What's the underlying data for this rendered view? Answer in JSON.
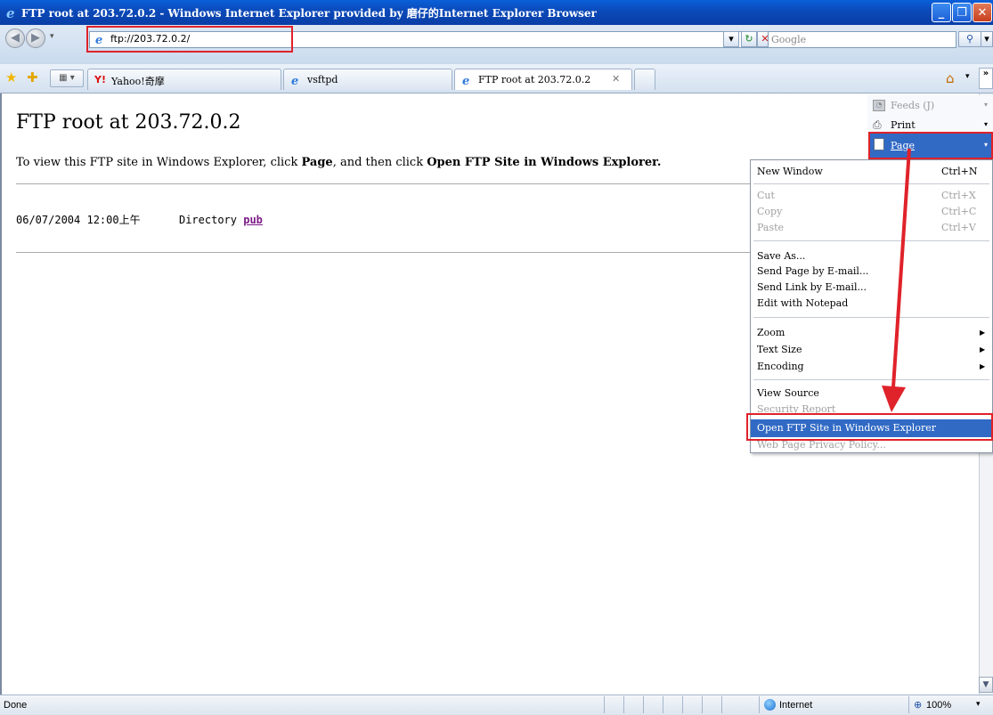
{
  "window": {
    "title": "FTP root at 203.72.0.2 - Windows Internet Explorer provided by 磨仔的Internet Explorer Browser"
  },
  "address_bar": {
    "url": "ftp://203.72.0.2/",
    "search_placeholder": "Google"
  },
  "tabs": [
    {
      "label": "Yahoo!奇摩",
      "active": false
    },
    {
      "label": "vsftpd",
      "active": false
    },
    {
      "label": "FTP root at 203.72.0.2",
      "active": true
    }
  ],
  "page": {
    "title": "FTP root at 203.72.0.2",
    "instruction_pre": "To view this FTP site in Windows Explorer, click ",
    "instruction_page": "Page",
    "instruction_mid": ", and then click ",
    "instruction_open": "Open FTP Site in Windows Explorer.",
    "listing_date": "06/07/2004 12:00上午",
    "listing_type": "Directory",
    "listing_link": "pub"
  },
  "command_bar": {
    "feeds": "Feeds (J)",
    "print": "Print",
    "page": "Page"
  },
  "page_menu": {
    "new_window": "New Window",
    "new_window_sc": "Ctrl+N",
    "cut": "Cut",
    "cut_sc": "Ctrl+X",
    "copy": "Copy",
    "copy_sc": "Ctrl+C",
    "paste": "Paste",
    "paste_sc": "Ctrl+V",
    "save_as": "Save As...",
    "send_page": "Send Page by E-mail...",
    "send_link": "Send Link by E-mail...",
    "edit_notepad": "Edit with Notepad",
    "zoom": "Zoom",
    "text_size": "Text Size",
    "encoding": "Encoding",
    "view_source": "View Source",
    "security_report": "Security Report",
    "open_ftp": "Open FTP Site in Windows Explorer",
    "privacy_policy": "Web Page Privacy Policy..."
  },
  "status_bar": {
    "status": "Done",
    "zone": "Internet",
    "zoom": "100%"
  },
  "colors": {
    "titlebar": "#0a4fc0",
    "highlight_red": "#e0222a",
    "menu_selected": "#316ac5",
    "link_visited": "#7b1a86"
  }
}
